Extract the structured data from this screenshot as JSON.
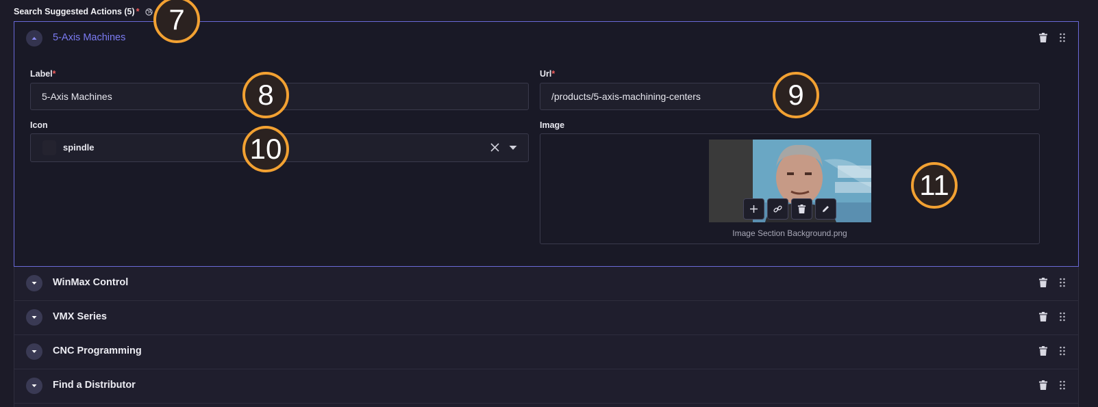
{
  "field": {
    "title": "Search Suggested Actions (5)",
    "required_mark": "*",
    "globe_icon": "globe-icon"
  },
  "open_item": {
    "title": "5-Axis Machines",
    "label_field": {
      "label": "Label",
      "required_mark": "*",
      "value": "5-Axis Machines"
    },
    "url_field": {
      "label": "Url",
      "required_mark": "*",
      "value": "/products/5-axis-machining-centers"
    },
    "icon_field": {
      "label": "Icon",
      "value": "spindle"
    },
    "image_field": {
      "label": "Image",
      "file_name": "Image Section Background.png"
    }
  },
  "collapsed_items": [
    {
      "title": "WinMax Control"
    },
    {
      "title": "VMX Series"
    },
    {
      "title": "CNC Programming"
    },
    {
      "title": "Find a Distributor"
    }
  ],
  "badges": [
    "7",
    "8",
    "9",
    "10",
    "11"
  ],
  "colors": {
    "background": "#1c1b28",
    "accent": "#7b7bf2",
    "required": "#f05d5d",
    "badge_border": "#f2a132"
  }
}
